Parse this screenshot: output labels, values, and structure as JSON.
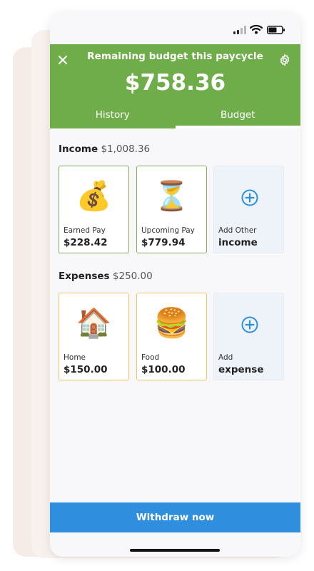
{
  "header": {
    "title": "Remaining budget this paycycle",
    "amount": "$758.36",
    "color": "#6fad4a",
    "close_icon": "close-icon",
    "settings_icon": "gear-icon"
  },
  "tabs": [
    {
      "label": "History",
      "active": false
    },
    {
      "label": "Budget",
      "active": true
    }
  ],
  "income": {
    "title": "Income",
    "total": "$1,008.36",
    "cards": [
      {
        "emoji": "💰",
        "label": "Earned Pay",
        "value": "$228.42"
      },
      {
        "emoji": "⏳",
        "label": "Upcoming Pay",
        "value": "$779.94"
      },
      {
        "icon": "plus-circle-icon",
        "label": "Add Other",
        "value": "income"
      }
    ]
  },
  "expenses": {
    "title": "Expenses",
    "total": "$250.00",
    "cards": [
      {
        "emoji": "🏠",
        "label": "Home",
        "value": "$150.00"
      },
      {
        "emoji": "🍔",
        "label": "Food",
        "value": "$100.00"
      },
      {
        "icon": "plus-circle-icon",
        "label": "Add",
        "value": "expense"
      }
    ]
  },
  "withdraw": {
    "label": "Withdraw now",
    "color": "#2f8fde"
  }
}
